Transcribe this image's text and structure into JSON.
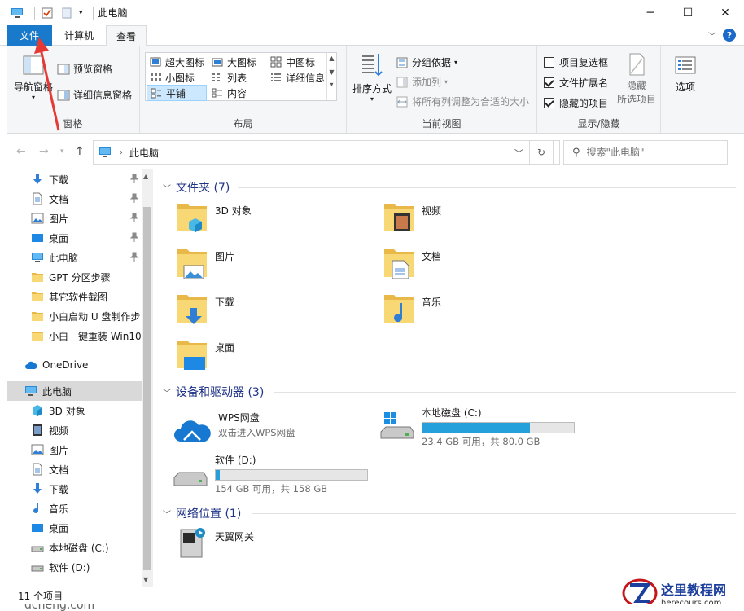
{
  "window": {
    "title": "此电脑",
    "minimize": "─",
    "maximize": "☐",
    "close": "✕"
  },
  "tabs": {
    "file": "文件",
    "computer": "计算机",
    "view": "查看",
    "collapse": "﹀",
    "help": "?"
  },
  "ribbon": {
    "panes": {
      "label": "窗格",
      "nav_pane": "导航窗格",
      "preview_pane": "预览窗格",
      "details_pane": "详细信息窗格"
    },
    "layout": {
      "label": "布局",
      "extra_large": "超大图标",
      "large": "大图标",
      "medium": "中图标",
      "small": "小图标",
      "list": "列表",
      "details": "详细信息",
      "tiles": "平铺",
      "content": "内容"
    },
    "current_view": {
      "label": "当前视图",
      "sort_by": "排序方式",
      "group_by": "分组依据",
      "add_columns": "添加列",
      "fit_columns": "将所有列调整为合适的大小"
    },
    "show_hide": {
      "label": "显示/隐藏",
      "item_checkboxes": "项目复选框",
      "file_extensions": "文件扩展名",
      "hidden_items": "隐藏的项目",
      "hide_selected": "隐藏",
      "hide_selected_2": "所选项目",
      "item_checkboxes_checked": false,
      "file_extensions_checked": true,
      "hidden_items_checked": true
    },
    "options": "选项"
  },
  "address": {
    "path": "此电脑",
    "search_placeholder": "搜索\"此电脑\""
  },
  "navpane": {
    "quick": [
      {
        "label": "下载",
        "icon": "download-icon",
        "pinned": true
      },
      {
        "label": "文档",
        "icon": "document-icon",
        "pinned": true
      },
      {
        "label": "图片",
        "icon": "picture-icon",
        "pinned": true
      },
      {
        "label": "桌面",
        "icon": "desktop-icon",
        "pinned": true
      },
      {
        "label": "此电脑",
        "icon": "computer-icon",
        "pinned": true
      },
      {
        "label": "GPT 分区步骤",
        "icon": "folder-icon",
        "pinned": false
      },
      {
        "label": "其它软件截图",
        "icon": "folder-icon",
        "pinned": false
      },
      {
        "label": "小白启动 U 盘制作步",
        "icon": "folder-icon",
        "pinned": false
      },
      {
        "label": "小白一键重装 Win10",
        "icon": "folder-icon",
        "pinned": false
      }
    ],
    "onedrive": "OneDrive",
    "this_pc": "此电脑",
    "pc_children": [
      {
        "label": "3D 对象",
        "icon": "3d-objects-icon"
      },
      {
        "label": "视频",
        "icon": "video-icon"
      },
      {
        "label": "图片",
        "icon": "picture-icon"
      },
      {
        "label": "文档",
        "icon": "document-icon"
      },
      {
        "label": "下载",
        "icon": "download-icon"
      },
      {
        "label": "音乐",
        "icon": "music-icon"
      },
      {
        "label": "桌面",
        "icon": "desktop-icon"
      },
      {
        "label": "本地磁盘 (C:)",
        "icon": "drive-icon"
      },
      {
        "label": "软件 (D:)",
        "icon": "drive-icon"
      }
    ]
  },
  "main": {
    "folders_header": "文件夹 (7)",
    "folders": [
      {
        "label": "3D 对象",
        "icon": "3d-objects-folder-icon"
      },
      {
        "label": "视频",
        "icon": "video-folder-icon"
      },
      {
        "label": "图片",
        "icon": "picture-folder-icon"
      },
      {
        "label": "文档",
        "icon": "document-folder-icon"
      },
      {
        "label": "下载",
        "icon": "download-folder-icon"
      },
      {
        "label": "音乐",
        "icon": "music-folder-icon"
      },
      {
        "label": "桌面",
        "icon": "desktop-folder-icon"
      }
    ],
    "devices_header": "设备和驱动器 (3)",
    "wps": {
      "name": "WPS网盘",
      "sub": "双击进入WPS网盘"
    },
    "drive_c": {
      "name": "本地磁盘 (C:)",
      "sub": "23.4 GB 可用，共 80.0 GB",
      "used_fraction": 0.7075
    },
    "drive_d": {
      "name": "软件 (D:)",
      "sub": "154 GB 可用，共 158 GB",
      "used_fraction": 0.0253
    },
    "network_header": "网络位置 (1)",
    "network": [
      {
        "label": "天翼网关",
        "icon": "media-server-icon"
      }
    ]
  },
  "status": {
    "count": "11 个项目"
  },
  "watermark": {
    "title": "这里教程网",
    "url": "herecours.com",
    "bottom_fragment": "dcheng.com"
  },
  "colors": {
    "accent": "#1979ca",
    "selection": "#cce8ff",
    "drive_fill": "#26a0da",
    "folder": "#f8d775",
    "section_header": "#1e3287"
  }
}
